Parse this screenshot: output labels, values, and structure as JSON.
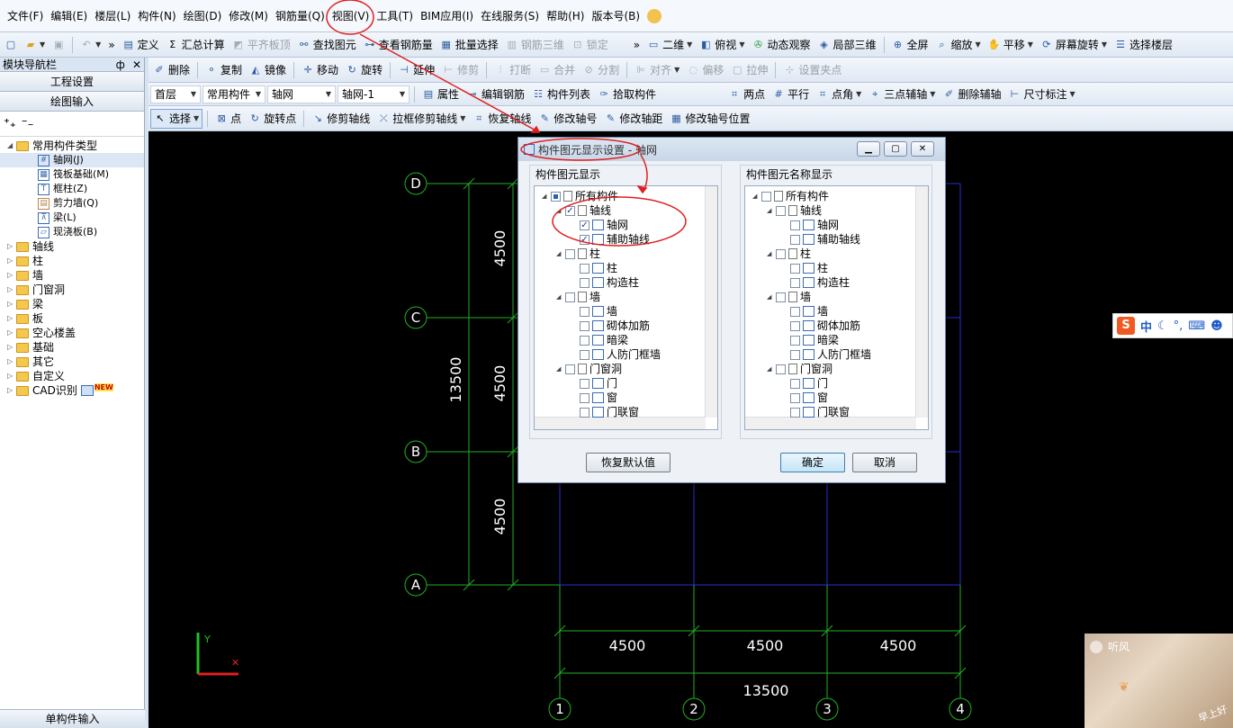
{
  "menubar": {
    "items": [
      "文件(F)",
      "编辑(E)",
      "楼层(L)",
      "构件(N)",
      "绘图(D)",
      "修改(M)",
      "钢筋量(Q)",
      "视图(V)",
      "工具(T)",
      "BIM应用(I)",
      "在线服务(S)",
      "帮助(H)",
      "版本号(B)"
    ]
  },
  "toolbar1": {
    "items": [
      "定义",
      "汇总计算",
      "平齐板顶",
      "查找图元",
      "查看钢筋量",
      "批量选择",
      "钢筋三维",
      "锁定"
    ],
    "right_items": [
      "二维",
      "俯视",
      "动态观察",
      "局部三维",
      "全屏",
      "缩放",
      "平移",
      "屏幕旋转",
      "选择楼层"
    ]
  },
  "toolbar2": {
    "items": [
      "删除",
      "复制",
      "镜像",
      "移动",
      "旋转",
      "延伸",
      "修剪",
      "打断",
      "合并",
      "分割",
      "对齐",
      "偏移",
      "拉伸",
      "设置夹点"
    ]
  },
  "toolbar3": {
    "floor": "首层",
    "category": "常用构件",
    "component": "轴网",
    "instance": "轴网-1",
    "items": [
      "属性",
      "编辑钢筋",
      "构件列表",
      "拾取构件"
    ],
    "right_items": [
      "两点",
      "平行",
      "点角",
      "三点辅轴",
      "删除辅轴",
      "尺寸标注"
    ]
  },
  "toolbar4": {
    "items": [
      "选择",
      "点",
      "旋转点",
      "修剪轴线",
      "拉框修剪轴线",
      "恢复轴线",
      "修改轴号",
      "修改轴距",
      "修改轴号位置"
    ]
  },
  "nav": {
    "title": "模块导航栏",
    "pin": "ф",
    "close": "✕",
    "btn1": "工程设置",
    "btn2": "绘图输入",
    "bottom": "单构件输入",
    "tree": {
      "root": "常用构件类型",
      "children": [
        "轴网(J)",
        "筏板基础(M)",
        "框柱(Z)",
        "剪力墙(Q)",
        "梁(L)",
        "现浇板(B)"
      ],
      "folders": [
        "轴线",
        "柱",
        "墙",
        "门窗洞",
        "梁",
        "板",
        "空心楼盖",
        "基础",
        "其它",
        "自定义",
        "CAD识别"
      ],
      "new_badge": "NEW"
    }
  },
  "canvas": {
    "axis_labels_rows": [
      "D",
      "C",
      "B",
      "A"
    ],
    "axis_labels_cols": [
      "1",
      "2",
      "3",
      "4"
    ],
    "dims_vertical": [
      "4500",
      "4500",
      "4500"
    ],
    "dim_vertical_total": "13500",
    "dims_horizontal": [
      "4500",
      "4500",
      "4500"
    ],
    "dim_horizontal_total": "13500",
    "ucs_y": "Y",
    "colors": {
      "grid": "#2b2bd8",
      "dim": "#22b022",
      "text": "#ffffff",
      "highlight": "#e02020"
    }
  },
  "dialog": {
    "title": "构件图元显示设置 - 轴网",
    "left_group": "构件图元显示",
    "right_group": "构件图元名称显示",
    "left_items": [
      {
        "label": "所有构件",
        "level": 0,
        "state": "part"
      },
      {
        "label": "轴线",
        "level": 1,
        "state": "checked"
      },
      {
        "label": "轴网",
        "level": 2,
        "state": "checked"
      },
      {
        "label": "辅助轴线",
        "level": 2,
        "state": "checked"
      },
      {
        "label": "柱",
        "level": 1,
        "state": "none"
      },
      {
        "label": "柱",
        "level": 2,
        "state": "none"
      },
      {
        "label": "构造柱",
        "level": 2,
        "state": "none"
      },
      {
        "label": "墙",
        "level": 1,
        "state": "none"
      },
      {
        "label": "墙",
        "level": 2,
        "state": "none"
      },
      {
        "label": "砌体加筋",
        "level": 2,
        "state": "none"
      },
      {
        "label": "暗梁",
        "level": 2,
        "state": "none"
      },
      {
        "label": "人防门框墙",
        "level": 2,
        "state": "none"
      },
      {
        "label": "门窗洞",
        "level": 1,
        "state": "none"
      },
      {
        "label": "门",
        "level": 2,
        "state": "none"
      },
      {
        "label": "窗",
        "level": 2,
        "state": "none"
      },
      {
        "label": "门联窗",
        "level": 2,
        "state": "none"
      }
    ],
    "right_items": [
      {
        "label": "所有构件",
        "level": 0,
        "state": "none"
      },
      {
        "label": "轴线",
        "level": 1,
        "state": "none"
      },
      {
        "label": "轴网",
        "level": 2,
        "state": "none"
      },
      {
        "label": "辅助轴线",
        "level": 2,
        "state": "none"
      },
      {
        "label": "柱",
        "level": 1,
        "state": "none"
      },
      {
        "label": "柱",
        "level": 2,
        "state": "none"
      },
      {
        "label": "构造柱",
        "level": 2,
        "state": "none"
      },
      {
        "label": "墙",
        "level": 1,
        "state": "none"
      },
      {
        "label": "墙",
        "level": 2,
        "state": "none"
      },
      {
        "label": "砌体加筋",
        "level": 2,
        "state": "none"
      },
      {
        "label": "暗梁",
        "level": 2,
        "state": "none"
      },
      {
        "label": "人防门框墙",
        "level": 2,
        "state": "none"
      },
      {
        "label": "门窗洞",
        "level": 1,
        "state": "none"
      },
      {
        "label": "门",
        "level": 2,
        "state": "none"
      },
      {
        "label": "窗",
        "level": 2,
        "state": "none"
      },
      {
        "label": "门联窗",
        "level": 2,
        "state": "none"
      }
    ],
    "restore_btn": "恢复默认值",
    "ok_btn": "确定",
    "cancel_btn": "取消"
  },
  "ime": {
    "logo": "S",
    "mode": "中"
  },
  "notification": {
    "title": "听风",
    "corner": "早上好"
  }
}
